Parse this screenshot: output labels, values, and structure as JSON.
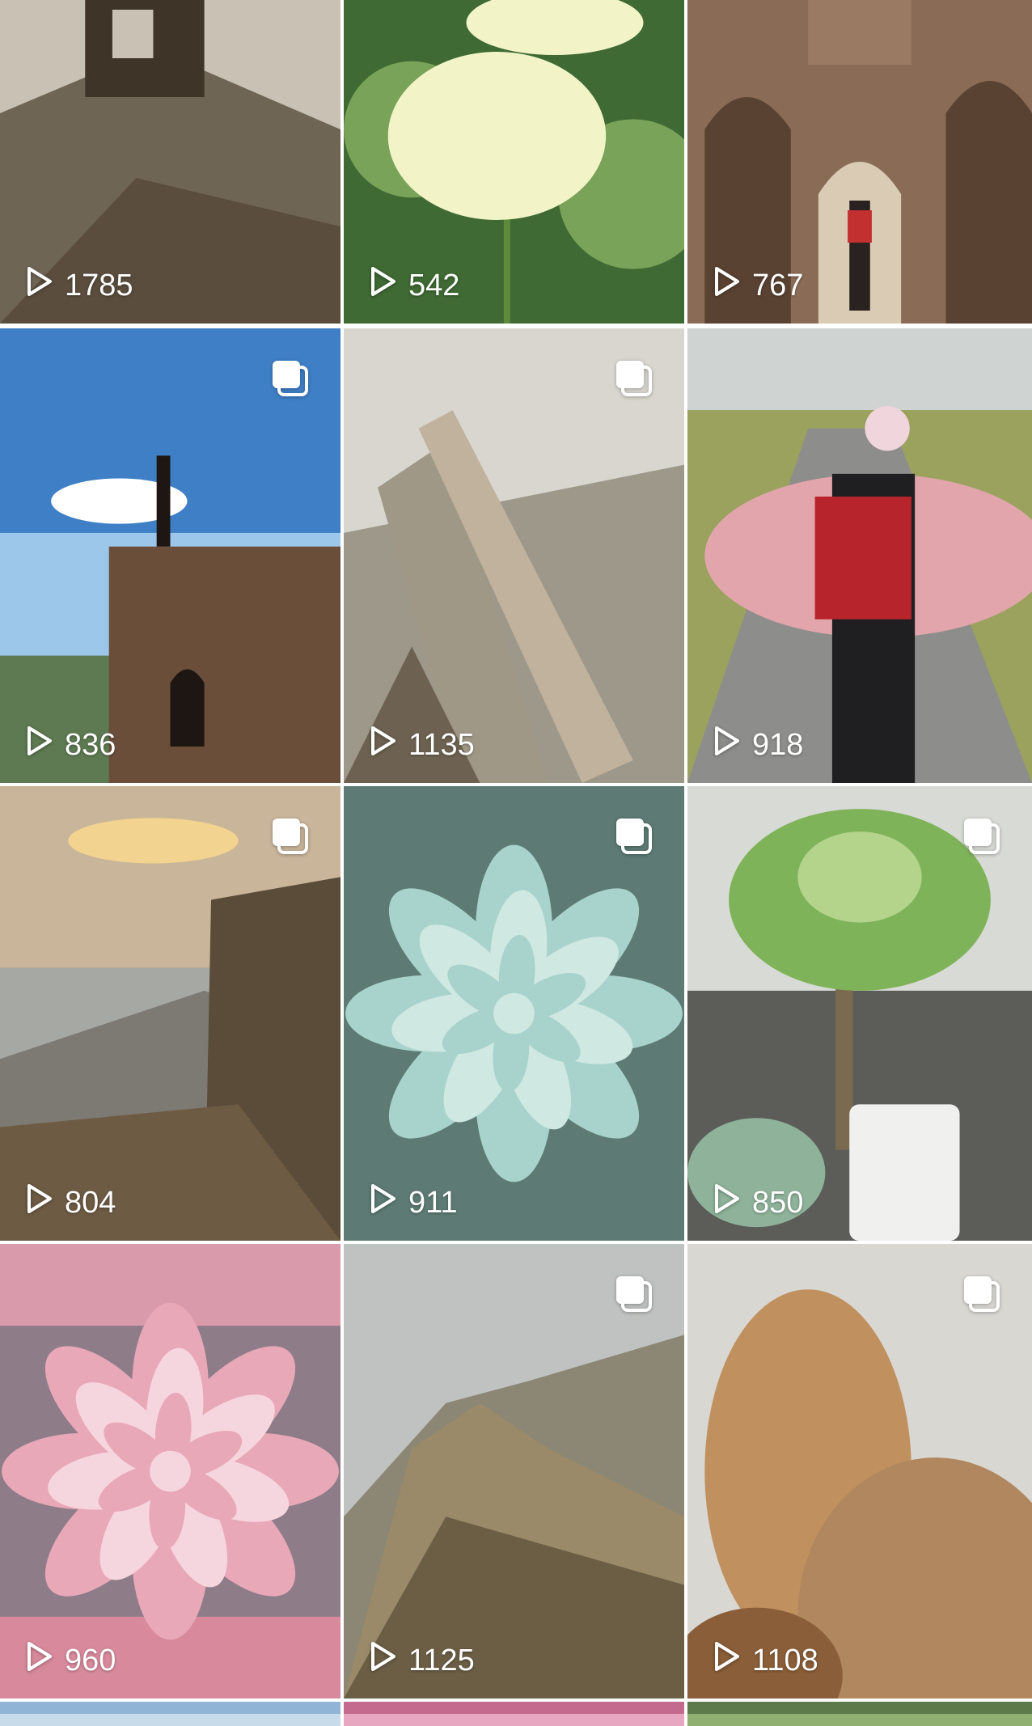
{
  "grid": {
    "items": [
      {
        "views": "1785",
        "multi": false,
        "scene": "ruins",
        "colors": [
          "#c9c2b4",
          "#6f6555",
          "#3e3528"
        ]
      },
      {
        "views": "542",
        "multi": false,
        "scene": "flower",
        "colors": [
          "#3f6a33",
          "#7aa35a",
          "#f2f4c8"
        ]
      },
      {
        "views": "767",
        "multi": false,
        "scene": "tunnel",
        "colors": [
          "#8a6c56",
          "#5a4232",
          "#d9cbb4"
        ]
      },
      {
        "views": "836",
        "multi": true,
        "scene": "tower",
        "colors": [
          "#3f7fc6",
          "#9cc6ea",
          "#6a4e3a"
        ]
      },
      {
        "views": "1135",
        "multi": true,
        "scene": "rocks",
        "colors": [
          "#d8d6cf",
          "#a09887",
          "#6d6251"
        ]
      },
      {
        "views": "918",
        "multi": false,
        "scene": "hiker",
        "colors": [
          "#cfd3d2",
          "#9aa25e",
          "#e2a5ac"
        ]
      },
      {
        "views": "804",
        "multi": true,
        "scene": "sunset",
        "colors": [
          "#c9b59a",
          "#7c7a72",
          "#5b4c3a"
        ]
      },
      {
        "views": "911",
        "multi": true,
        "scene": "succulent",
        "colors": [
          "#a8d3cc",
          "#cfe8e1",
          "#5d7b74"
        ]
      },
      {
        "views": "850",
        "multi": true,
        "scene": "plants",
        "colors": [
          "#7fb35a",
          "#b4d48c",
          "#5c5c58"
        ]
      },
      {
        "views": "960",
        "multi": false,
        "scene": "pinkbloom",
        "colors": [
          "#e9a8b8",
          "#f6d6de",
          "#8e7d88"
        ]
      },
      {
        "views": "1125",
        "multi": true,
        "scene": "mountain",
        "colors": [
          "#bfc2c0",
          "#9a8a6a",
          "#6b5e45"
        ]
      },
      {
        "views": "1108",
        "multi": true,
        "scene": "boulder",
        "colors": [
          "#d8d7d2",
          "#c0905e",
          "#8a5e38"
        ]
      },
      {
        "views": "",
        "multi": false,
        "scene": "sky",
        "colors": [
          "#8fb4d6",
          "#c7dbea",
          "#8fb4d6"
        ]
      },
      {
        "views": "",
        "multi": false,
        "scene": "bloom",
        "colors": [
          "#c46a8e",
          "#e7a7c0",
          "#7b9a74"
        ]
      },
      {
        "views": "",
        "multi": false,
        "scene": "leaves",
        "colors": [
          "#5c7a4a",
          "#8fb070",
          "#3f5535"
        ]
      }
    ]
  },
  "icons": {
    "play": "play-outline-icon",
    "multi": "multi-image-icon"
  }
}
